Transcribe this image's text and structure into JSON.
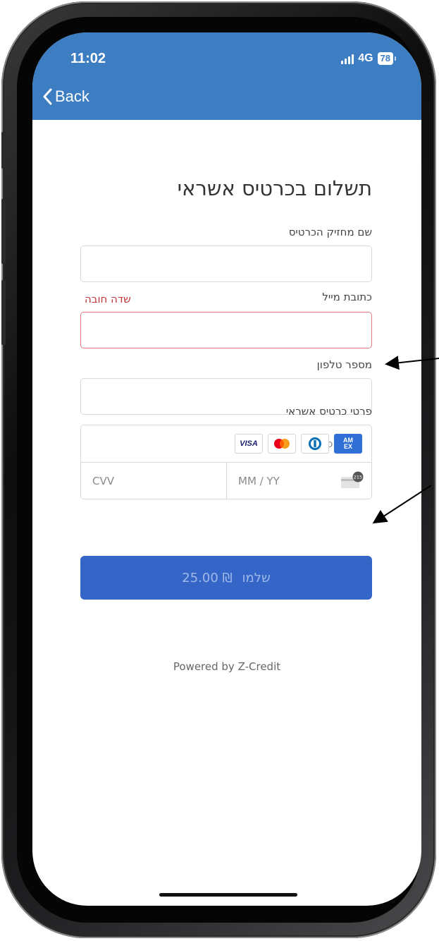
{
  "status_bar": {
    "time": "11:02",
    "network": "4G",
    "battery": "78"
  },
  "nav": {
    "back_label": "Back"
  },
  "form": {
    "title": "תשלום בכרטיס אשראי",
    "name_label": "שם מחזיק הכרטיס",
    "name_value": "",
    "email_label": "כתובת מייל",
    "email_error": "שדה חובה",
    "email_value": "",
    "phone_label": "מספר טלפון",
    "phone_value": "",
    "card_section_label": "פרטי כרטיס אשראי",
    "card_number_placeholder": "מספר כרטיס",
    "expiry_placeholder": "MM / YY",
    "cvv_placeholder": "CVV",
    "card_brands": [
      "VISA",
      "Mastercard",
      "Diners Club",
      "AMEX"
    ],
    "cvv_icon_text": "215"
  },
  "pay_button": {
    "label": "שלמו",
    "amount": "₪ 25.00"
  },
  "footer": {
    "powered_by": "Powered by Z-Credit"
  },
  "colors": {
    "header": "#3d7ec3",
    "pay_button": "#3566c7",
    "error": "#c2383b"
  }
}
